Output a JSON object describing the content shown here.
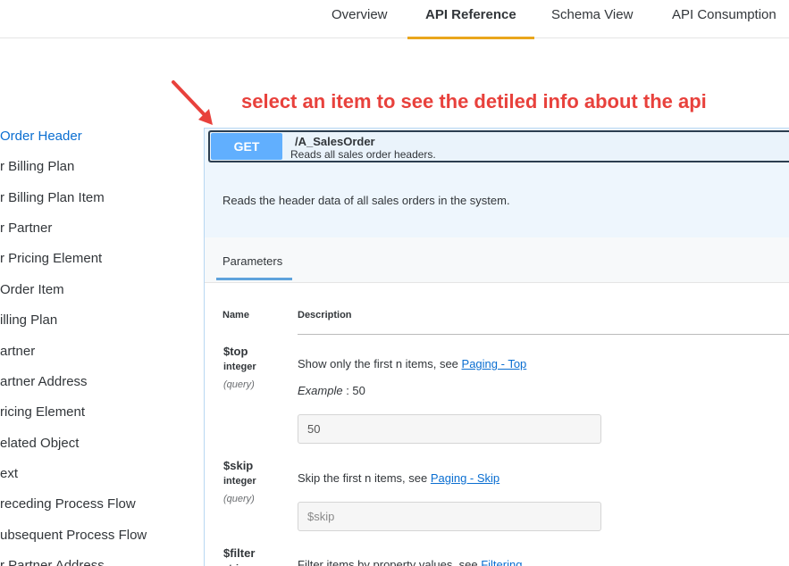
{
  "topnav": {
    "tabs": [
      {
        "label": "Overview"
      },
      {
        "label": "API Reference",
        "active": true
      },
      {
        "label": "Schema View"
      },
      {
        "label": "API Consumption"
      }
    ],
    "accent_color": "#e9a61c"
  },
  "annotation": {
    "text": "select an item to see the detiled info about the api",
    "color": "#e8413c"
  },
  "sidebar": {
    "items": [
      {
        "label": "Order Header",
        "selected": true
      },
      {
        "label": "r Billing Plan"
      },
      {
        "label": "r Billing Plan Item"
      },
      {
        "label": "r Partner"
      },
      {
        "label": "r Pricing Element"
      },
      {
        "label": "Order Item"
      },
      {
        "label": "illing Plan"
      },
      {
        "label": "artner"
      },
      {
        "label": "artner Address"
      },
      {
        "label": "ricing Element"
      },
      {
        "label": "elated Object"
      },
      {
        "label": "ext"
      },
      {
        "label": "receding Process Flow"
      },
      {
        "label": "ubsequent Process Flow"
      },
      {
        "label": "r Partner Address"
      }
    ]
  },
  "endpoint": {
    "method": "GET",
    "method_color": "#61affe",
    "path": "/A_SalesOrder",
    "summary": "Reads all sales order headers.",
    "description": "Reads the header data of all sales orders in the system."
  },
  "parameters": {
    "tab_label": "Parameters",
    "col_name": "Name",
    "col_description": "Description",
    "items": [
      {
        "name": "$top",
        "type": "integer",
        "in": "(query)",
        "desc": "Show only the first n items, see ",
        "link": "Paging - Top",
        "example_label": "Example",
        "example_value": " : 50",
        "input_value": "50",
        "input_placeholder": "50"
      },
      {
        "name": "$skip",
        "type": "integer",
        "in": "(query)",
        "desc": "Skip the first n items, see ",
        "link": "Paging - Skip",
        "input_value": "",
        "input_placeholder": "$skip"
      },
      {
        "name": "$filter",
        "type": "string",
        "desc": "Filter items by property values, see ",
        "link": "Filtering"
      }
    ]
  }
}
